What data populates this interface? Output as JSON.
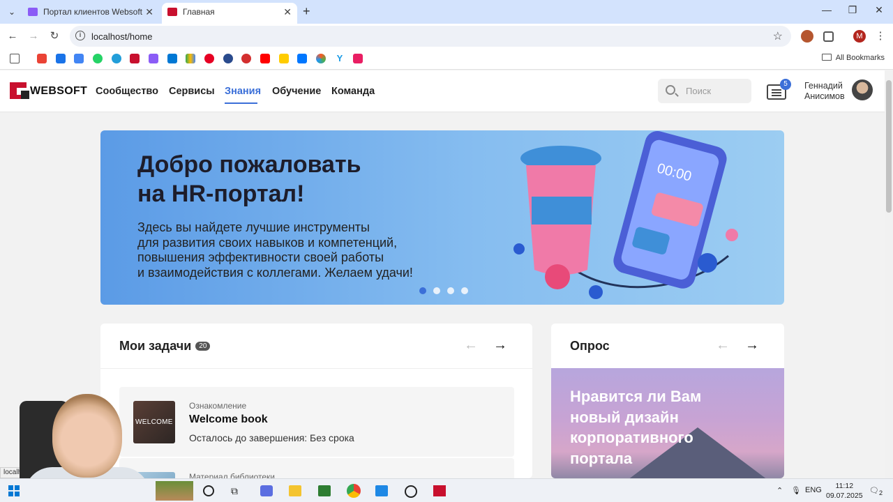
{
  "browser": {
    "tabs": [
      {
        "title": "Портал клиентов Websoft",
        "active": false,
        "favicon_color": "#8b5cf6"
      },
      {
        "title": "Главная",
        "active": true,
        "favicon_color": "#c8102e"
      }
    ],
    "url": "localhost/home",
    "profile_initial": "M",
    "all_bookmarks": "All Bookmarks",
    "bookmark_icons": [
      "gmail-icon",
      "chat-icon",
      "calendar-icon",
      "whatsapp-icon",
      "telegram-icon",
      "websoft-icon",
      "purple-icon",
      "cloud-icon",
      "drive-icon",
      "pinterest-icon",
      "app-icon",
      "apple-icon",
      "youtube-icon",
      "yellow-icon",
      "vk-icon",
      "ai-icon",
      "y-icon",
      "pink-icon"
    ]
  },
  "site": {
    "logo": "WEBSOFT",
    "nav": [
      "Сообщество",
      "Сервисы",
      "Знания",
      "Обучение",
      "Команда"
    ],
    "active_nav": "Знания",
    "search_placeholder": "Поиск",
    "messages_count": "5",
    "user_first": "Геннадий",
    "user_last": "Анисимов"
  },
  "hero": {
    "title_line1": "Добро пожаловать",
    "title_line2": "на HR-портал!",
    "desc_lines": [
      "Здесь вы найдете лучшие инструменты",
      "для развития своих навыков и компетенций,",
      "повышения эффективности своей работы",
      "и взаимодействия с коллегами. Желаем удачи!"
    ],
    "slides": 4,
    "active_slide": 1
  },
  "tasks": {
    "title": "Мои задачи",
    "count": "20",
    "items": [
      {
        "category": "Ознакомление",
        "name": "Welcome book",
        "due": "Осталось до завершения: Без срока",
        "thumb_text": "WELCOME"
      },
      {
        "category": "Материал библиотеки",
        "name": "",
        "due": "",
        "thumb_text": ""
      }
    ]
  },
  "poll": {
    "title": "Опрос",
    "question_lines": [
      "Нравится ли Вам",
      "новый дизайн",
      "корпоративного",
      "портала"
    ]
  },
  "status_url": "localhost",
  "taskbar": {
    "lang": "ENG",
    "time": "11:12",
    "date": "09.07.2025",
    "notifications": "2"
  },
  "colors": {
    "accent": "#3b6fd8",
    "brand": "#c8102e"
  }
}
